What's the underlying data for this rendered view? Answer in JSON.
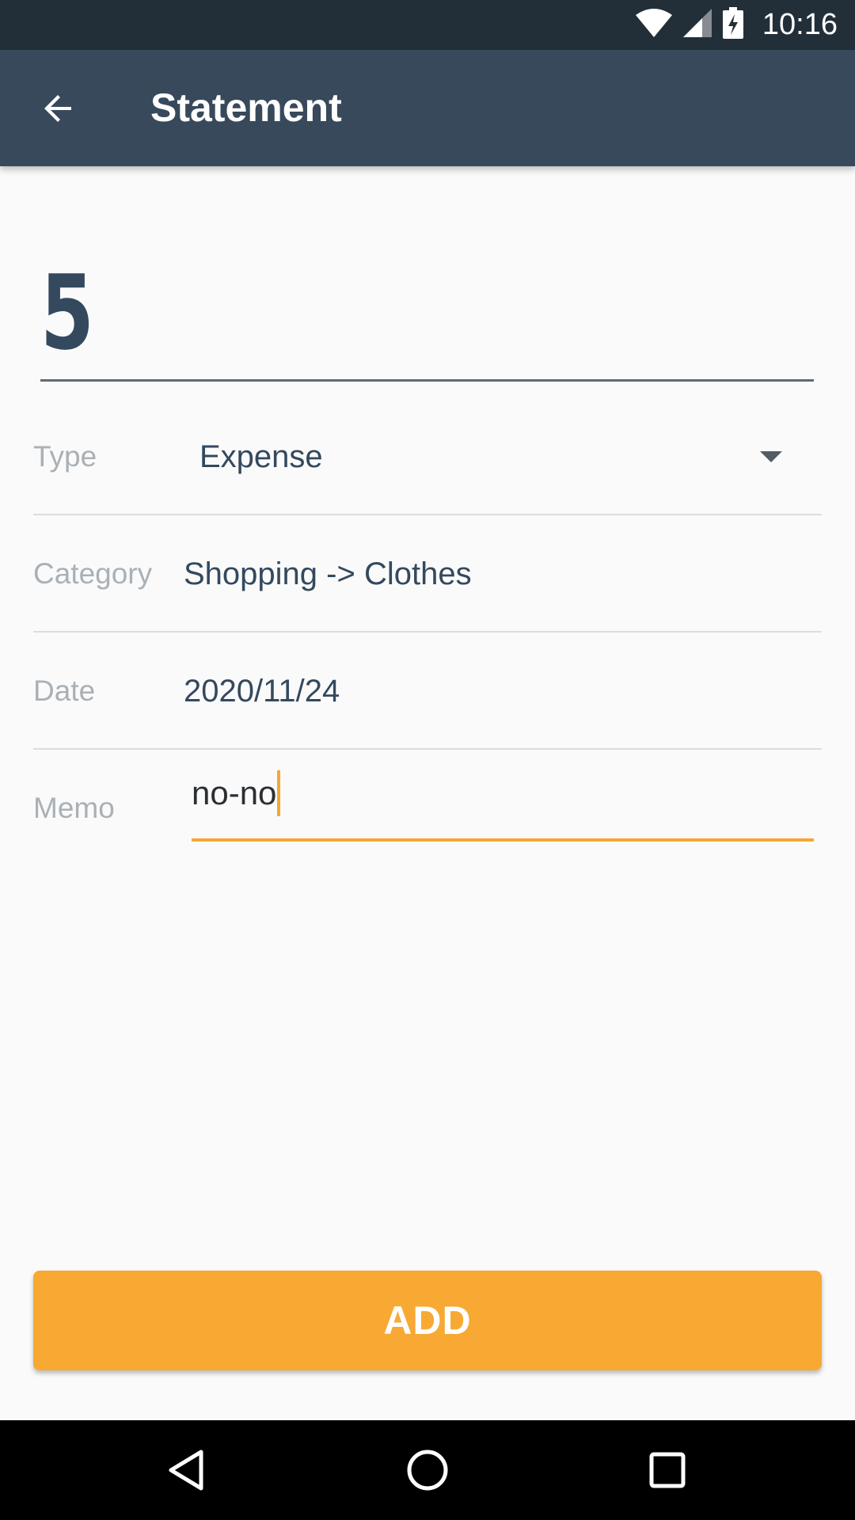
{
  "status_bar": {
    "time": "10:16",
    "icons": [
      "wifi-icon",
      "cell-signal-icon",
      "battery-charging-icon"
    ]
  },
  "app_bar": {
    "title": "Statement",
    "back_icon": "arrow-back-icon"
  },
  "amount": {
    "value": "5"
  },
  "form": {
    "type": {
      "label": "Type",
      "value": "Expense"
    },
    "category": {
      "label": "Category",
      "value": "Shopping -> Clothes"
    },
    "date": {
      "label": "Date",
      "value": "2020/11/24"
    },
    "memo": {
      "label": "Memo",
      "value": "no-no"
    }
  },
  "actions": {
    "add_label": "ADD"
  },
  "nav_bar": {
    "icons": [
      "back-triangle-icon",
      "home-circle-icon",
      "recents-square-icon"
    ]
  },
  "colors": {
    "status_bar": "#232f38",
    "app_bar": "#37495a",
    "accent": "#f7a934",
    "text_primary": "#34495e",
    "label": "#a9b1b7"
  }
}
